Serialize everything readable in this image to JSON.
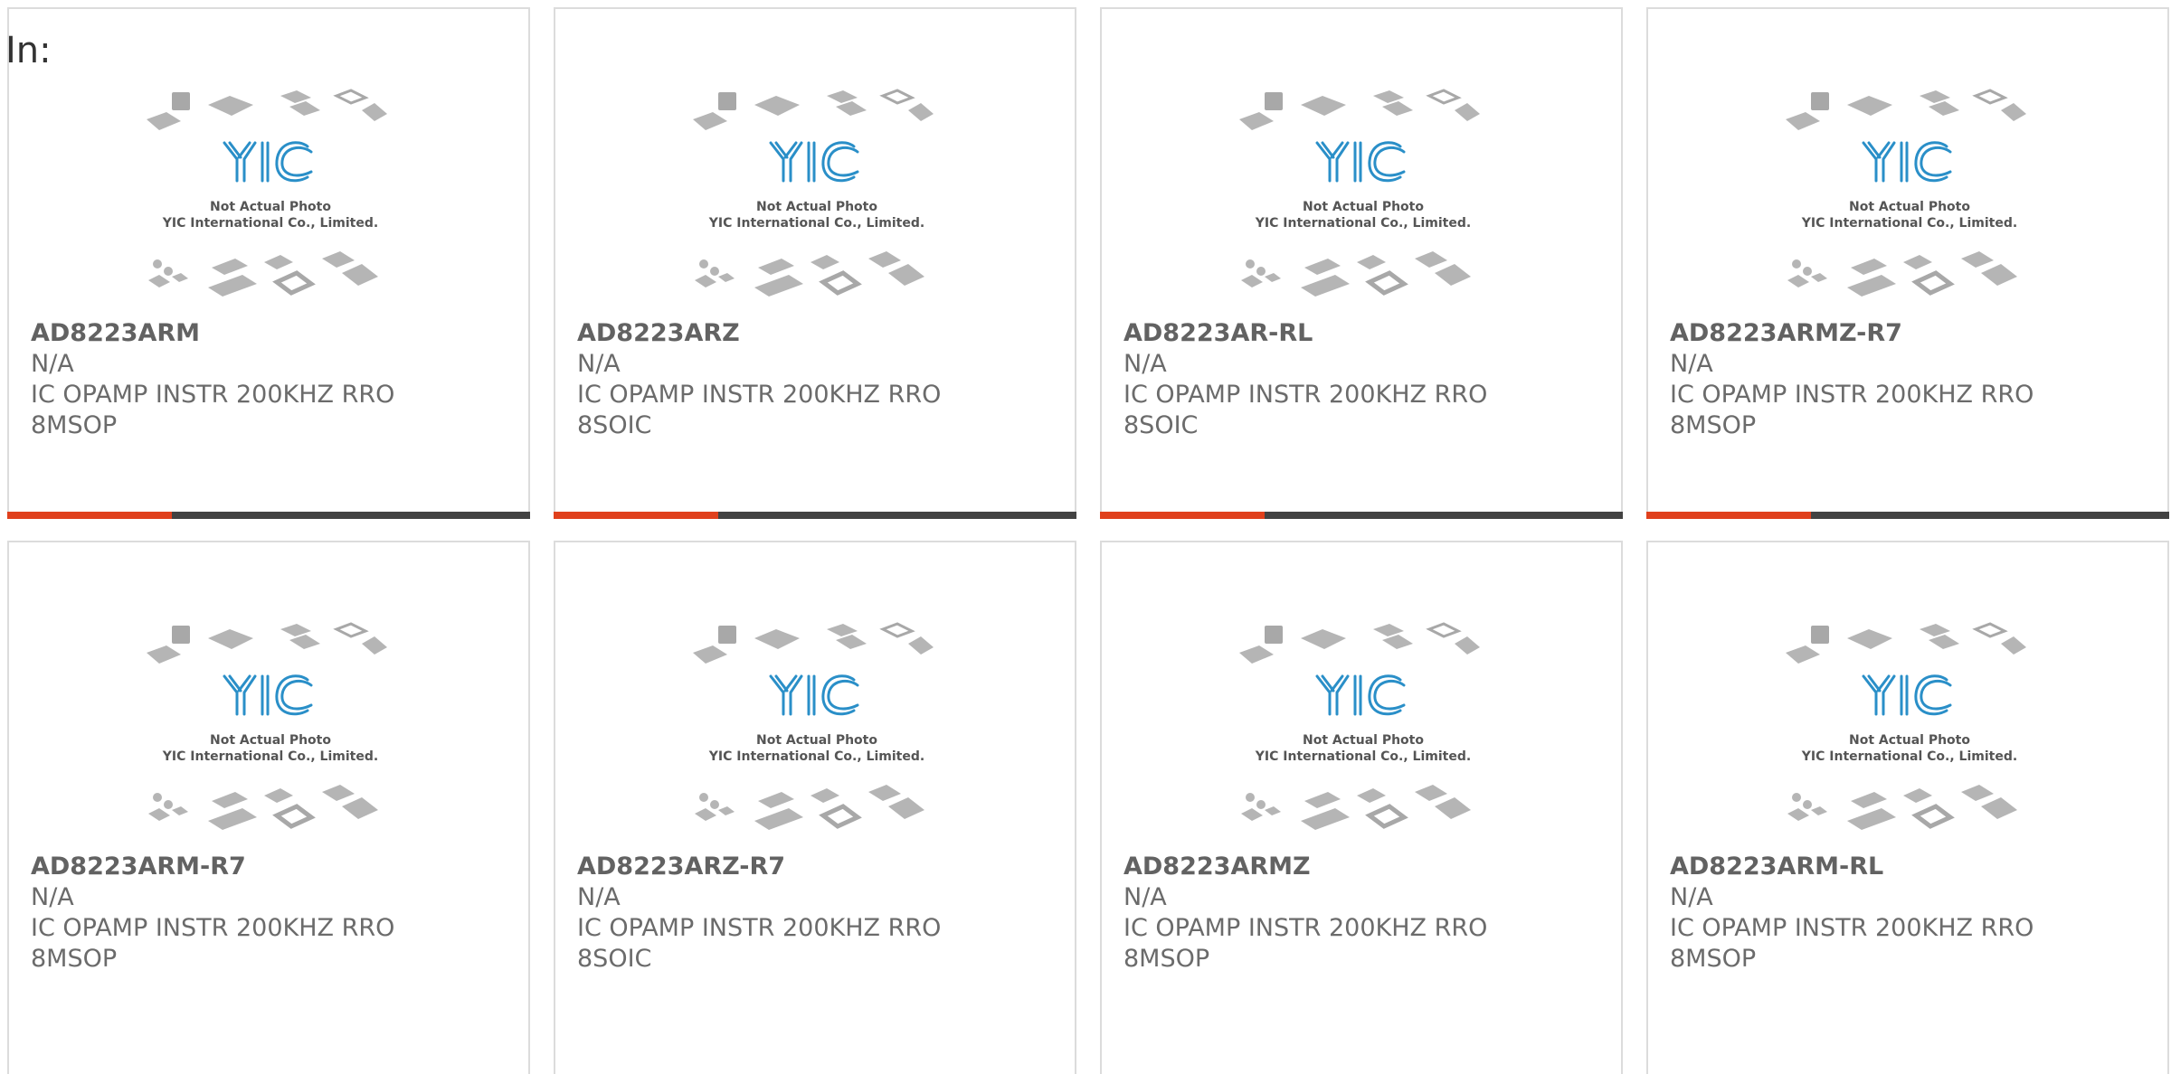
{
  "heading": "In:",
  "image_caption": {
    "line1": "Not Actual Photo",
    "line2": "YIC International Co., Limited.",
    "logo_text": "YIC"
  },
  "colors": {
    "accent": "#e0401c",
    "bar": "#424242",
    "logo_blue": "#2a8fc8",
    "text": "#6b6b6b"
  },
  "products": [
    {
      "part": "AD8223ARM",
      "status": "N/A",
      "desc1": "IC OPAMP INSTR 200KHZ RRO",
      "desc2": "8MSOP"
    },
    {
      "part": "AD8223ARZ",
      "status": "N/A",
      "desc1": "IC OPAMP INSTR 200KHZ RRO",
      "desc2": "8SOIC"
    },
    {
      "part": "AD8223AR-RL",
      "status": "N/A",
      "desc1": "IC OPAMP INSTR 200KHZ RRO",
      "desc2": "8SOIC"
    },
    {
      "part": "AD8223ARMZ-R7",
      "status": "N/A",
      "desc1": "IC OPAMP INSTR 200KHZ RRO",
      "desc2": "8MSOP"
    },
    {
      "part": "AD8223ARM-R7",
      "status": "N/A",
      "desc1": "IC OPAMP INSTR 200KHZ RRO",
      "desc2": "8MSOP"
    },
    {
      "part": "AD8223ARZ-R7",
      "status": "N/A",
      "desc1": "IC OPAMP INSTR 200KHZ RRO",
      "desc2": "8SOIC"
    },
    {
      "part": "AD8223ARMZ",
      "status": "N/A",
      "desc1": "IC OPAMP INSTR 200KHZ RRO",
      "desc2": "8MSOP"
    },
    {
      "part": "AD8223ARM-RL",
      "status": "N/A",
      "desc1": "IC OPAMP INSTR 200KHZ RRO",
      "desc2": "8MSOP"
    }
  ]
}
